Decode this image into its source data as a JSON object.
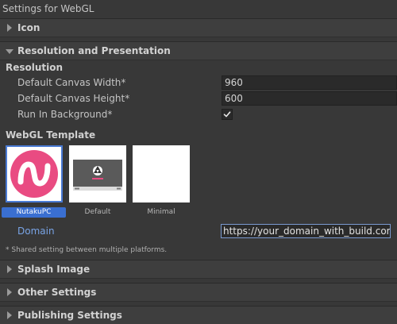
{
  "window": {
    "title": "Settings for WebGL"
  },
  "sections": {
    "icon": {
      "label": "Icon"
    },
    "resolution": {
      "label": "Resolution and Presentation"
    },
    "splash": {
      "label": "Splash Image"
    },
    "other": {
      "label": "Other Settings"
    },
    "publishing": {
      "label": "Publishing Settings"
    }
  },
  "resolution": {
    "sub_header": "Resolution",
    "canvas_width_label": "Default Canvas Width*",
    "canvas_width_value": "960",
    "canvas_height_label": "Default Canvas Height*",
    "canvas_height_value": "600",
    "run_in_background_label": "Run In Background*",
    "run_in_background_checked": true
  },
  "webgl_template": {
    "header": "WebGL Template",
    "templates": [
      {
        "label": "NutakuPC",
        "selected": true
      },
      {
        "label": "Default",
        "selected": false
      },
      {
        "label": "Minimal",
        "selected": false
      }
    ],
    "domain_label": "Domain",
    "domain_value": "https://your_domain_with_build.com"
  },
  "footnote": "* Shared setting between multiple platforms.",
  "colors": {
    "background": "#383838",
    "selection": "#3a6fd1",
    "link_label": "#79a4e6",
    "nutaku_pink": "#e94b82"
  }
}
